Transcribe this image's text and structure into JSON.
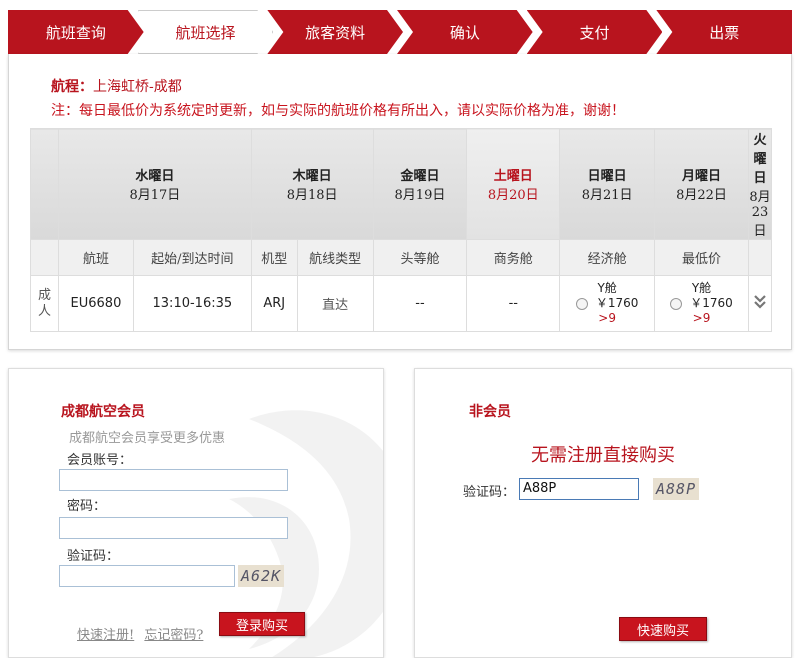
{
  "steps": [
    "航班查询",
    "航班选择",
    "旅客资料",
    "确认",
    "支付",
    "出票"
  ],
  "route": {
    "label": "航程：",
    "value": "上海虹桥-成都"
  },
  "note": "注：每日最低价为系统定时更新，如与实际的航班价格有所出入，请以实际价格为准，谢谢！",
  "dates": [
    {
      "weekday": "水曜日",
      "date": "8月17日"
    },
    {
      "weekday": "木曜日",
      "date": "8月18日"
    },
    {
      "weekday": "金曜日",
      "date": "8月19日"
    },
    {
      "weekday": "土曜日",
      "date": "8月20日"
    },
    {
      "weekday": "日曜日",
      "date": "8月21日"
    },
    {
      "weekday": "月曜日",
      "date": "8月22日"
    },
    {
      "weekday": "火曜日",
      "date": "8月23日"
    }
  ],
  "headers": [
    "航班",
    "起始/到达时间",
    "机型",
    "航线类型",
    "头等舱",
    "商务舱",
    "经济舱",
    "最低价"
  ],
  "flight": {
    "passenger": "成人",
    "number": "EU6680",
    "time": "13:10-16:35",
    "aircraft": "ARJ",
    "route_type": "直达",
    "first": "--",
    "business": "--",
    "economy": {
      "cabin": "Y舱",
      "price": "￥1760",
      "count": ">9"
    },
    "lowest": {
      "cabin": "Y舱",
      "price": "￥1760",
      "count": ">9"
    }
  },
  "member": {
    "title": "成都航空会员",
    "subtitle": "成都航空会员享受更多优惠",
    "account_label": "会员账号：",
    "password_label": "密码：",
    "captcha_label": "验证码：",
    "captcha_text": "A62K",
    "register_link": "快速注册!",
    "forgot_link": "忘记密码?",
    "login_button": "登录购买"
  },
  "nonmember": {
    "title": "非会员",
    "headline": "无需注册直接购买",
    "captcha_label": "验证码：",
    "captcha_value": "A88P",
    "captcha_text": "A88P",
    "buy_button": "快速购买"
  },
  "colors": {
    "brand": "#b8141e"
  },
  "icons": {
    "expand": "double-chevron-down-icon",
    "watermark": "bird-logo-icon"
  }
}
